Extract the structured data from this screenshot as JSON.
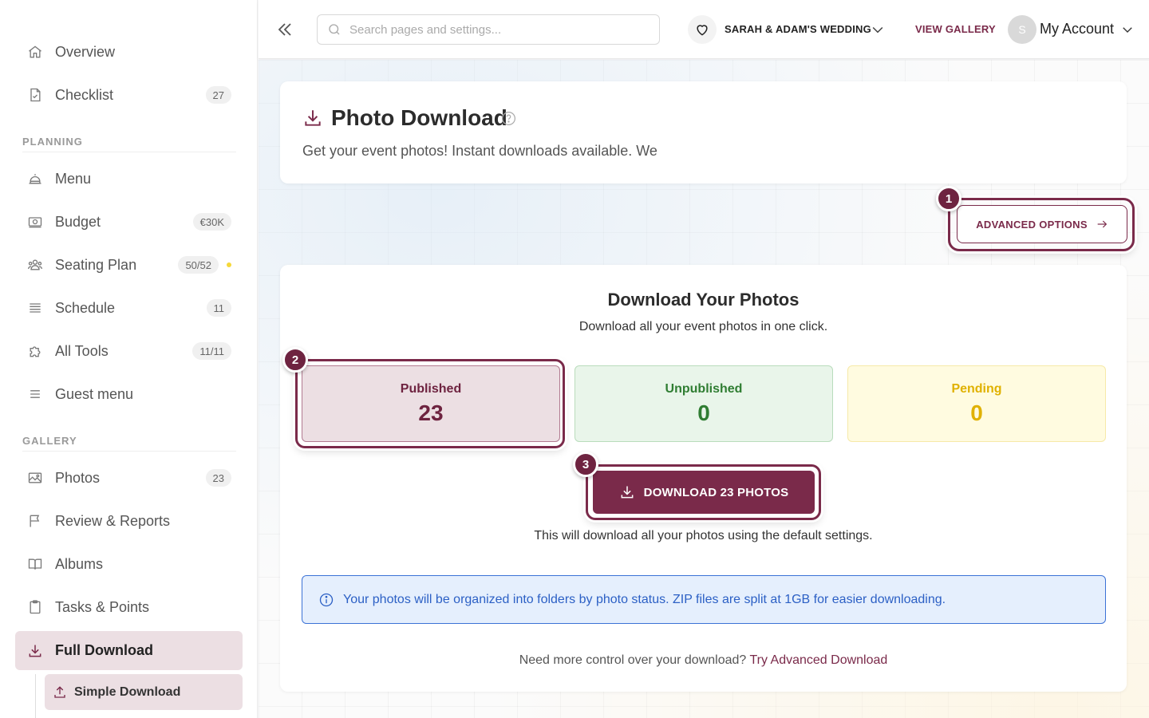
{
  "sidebar": {
    "items": [
      {
        "label": "Overview"
      },
      {
        "label": "Checklist",
        "badge": "27"
      },
      {
        "label": "Menu"
      },
      {
        "label": "Budget",
        "badge": "€30K"
      },
      {
        "label": "Seating Plan",
        "badge": "50/52"
      },
      {
        "label": "Schedule",
        "badge": "11"
      },
      {
        "label": "All Tools",
        "badge": "11/11"
      },
      {
        "label": "Guest menu"
      },
      {
        "label": "Photos",
        "badge": "23"
      },
      {
        "label": "Review & Reports"
      },
      {
        "label": "Albums"
      },
      {
        "label": "Tasks & Points"
      },
      {
        "label": "Full Download"
      }
    ],
    "sections": {
      "planning": "PLANNING",
      "gallery": "GALLERY"
    },
    "sub_item": {
      "label": "Simple Download"
    }
  },
  "header": {
    "search_placeholder": "Search pages and settings...",
    "event_name": "SARAH & ADAM'S WEDDING",
    "view_gallery": "VIEW GALLERY",
    "avatar_initial": "S",
    "account_label": "My Account"
  },
  "page": {
    "title": "Photo Download",
    "subtitle": "Get your event photos! Instant downloads available. We"
  },
  "advanced": {
    "label": "ADVANCED OPTIONS",
    "step": "1"
  },
  "download_card": {
    "heading": "Download Your Photos",
    "description": "Download all your event photos in one click.",
    "stats": {
      "published": {
        "label": "Published",
        "value": "23",
        "step": "2"
      },
      "unpublished": {
        "label": "Unpublished",
        "value": "0"
      },
      "pending": {
        "label": "Pending",
        "value": "0"
      }
    },
    "download_button": {
      "label": "DOWNLOAD 23 PHOTOS",
      "step": "3"
    },
    "note": "This will download all your photos using the default settings.",
    "info": "Your photos will be organized into folders by photo status. ZIP files are split at 1GB for easier downloading.",
    "footer_text": "Need more control over your download?",
    "footer_link": "Try Advanced Download"
  },
  "colors": {
    "brand": "#7a2a4a",
    "published_bg": "#ecdfe3",
    "unpublished": "#2f7d32",
    "pending": "#e0b100",
    "info": "#2c60c5"
  }
}
